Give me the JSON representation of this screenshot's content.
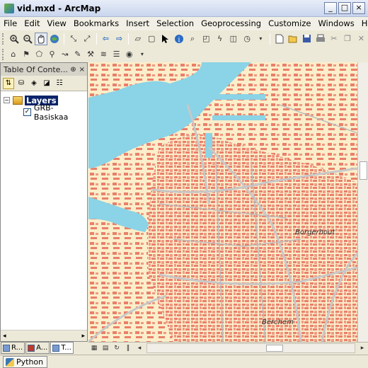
{
  "window": {
    "title": "vid.mxd - ArcMap",
    "min_glyph": "_",
    "max_glyph": "□",
    "close_glyph": "×"
  },
  "menu": [
    "File",
    "Edit",
    "View",
    "Bookmarks",
    "Insert",
    "Selection",
    "Geoprocessing",
    "Customize",
    "Windows",
    "Help"
  ],
  "toc": {
    "title": "Table Of Conte...",
    "pin_glyph": "⊕",
    "close_glyph": "×",
    "expand_glyph": "−",
    "layers_label": "Layers",
    "layer_name": "GRB-Basiskaa",
    "layer_checked_glyph": "✓",
    "tabs": [
      "R...",
      "A...",
      "T..."
    ]
  },
  "map": {
    "labels": [
      "Borgerhout",
      "Berchem"
    ],
    "colors": {
      "background": "#fbeeca",
      "water": "#8bd3e6",
      "buildings": "#e9806a",
      "roads": "#c8c8c8"
    }
  },
  "python_tab": "Python",
  "icons": [
    "zoom-in-icon",
    "zoom-out-icon",
    "pan-icon",
    "full-extent-icon",
    "back-icon",
    "forward-icon",
    "select-icon",
    "identify-icon",
    "new-doc-icon",
    "open-icon",
    "save-icon",
    "print-icon",
    "cut-icon",
    "copy-icon",
    "delete-icon",
    "layers-icon",
    "checkbox-icon"
  ]
}
